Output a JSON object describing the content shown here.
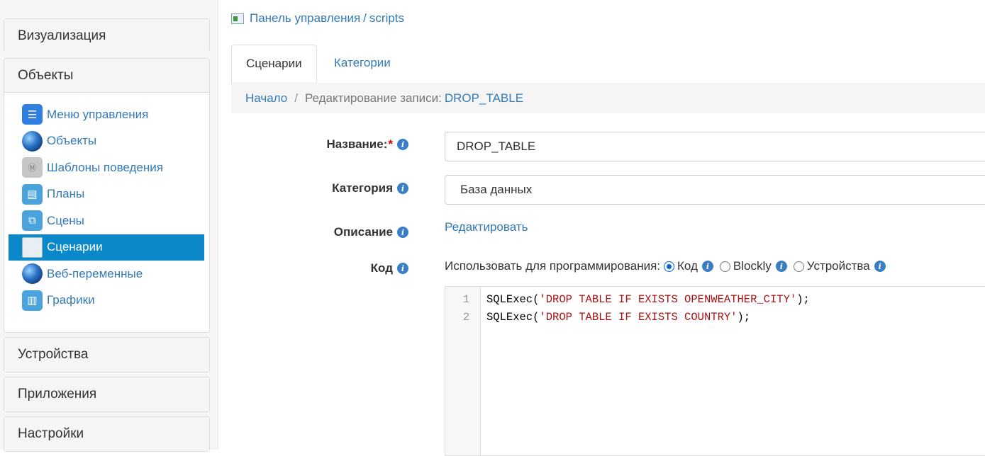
{
  "sidebar": {
    "sections": [
      {
        "label": "Визуализация"
      },
      {
        "label": "Объекты"
      },
      {
        "label": "Устройства"
      },
      {
        "label": "Приложения"
      },
      {
        "label": "Настройки"
      }
    ],
    "items": [
      {
        "label": "Меню управления",
        "icon": "menu-list-icon"
      },
      {
        "label": "Объекты",
        "icon": "globe-icon"
      },
      {
        "label": "Шаблоны поведения",
        "icon": "template-icon"
      },
      {
        "label": "Планы",
        "icon": "plan-icon"
      },
      {
        "label": "Сцены",
        "icon": "scenes-icon"
      },
      {
        "label": "Сценарии",
        "icon": "scripts-icon"
      },
      {
        "label": "Веб-переменные",
        "icon": "web-globe-icon"
      },
      {
        "label": "Графики",
        "icon": "chart-icon"
      }
    ]
  },
  "top_breadcrumb": {
    "root": "Панель управления",
    "separator": "/",
    "current": "scripts"
  },
  "tabs": [
    "Сценарии",
    "Категории"
  ],
  "breadcrumb": {
    "home": "Начало",
    "separator": "/",
    "current": "Редактирование записи:",
    "record": "DROP_TABLE"
  },
  "form": {
    "name_label": "Название:",
    "required_mark": "*",
    "name_value": "DROP_TABLE",
    "category_label": "Категория",
    "category_value": "База данных",
    "description_label": "Описание",
    "description_link": "Редактировать",
    "code_label": "Код",
    "programming_prefix": "Использовать для программирования:",
    "options": [
      "Код",
      "Blockly",
      "Устройства"
    ],
    "selected_option": "Код"
  },
  "editor": {
    "line_numbers": [
      "1",
      "2"
    ],
    "lines": [
      {
        "pre": "SQLExec(",
        "str": "'DROP TABLE IF EXISTS OPENWEATHER_CITY'",
        "post": ");"
      },
      {
        "pre": "SQLExec(",
        "str": "'DROP TABLE IF EXISTS COUNTRY'",
        "post": ");"
      }
    ]
  },
  "colors": {
    "link": "#337ab7",
    "active_item": "#0a88c9",
    "string": "#a11"
  }
}
